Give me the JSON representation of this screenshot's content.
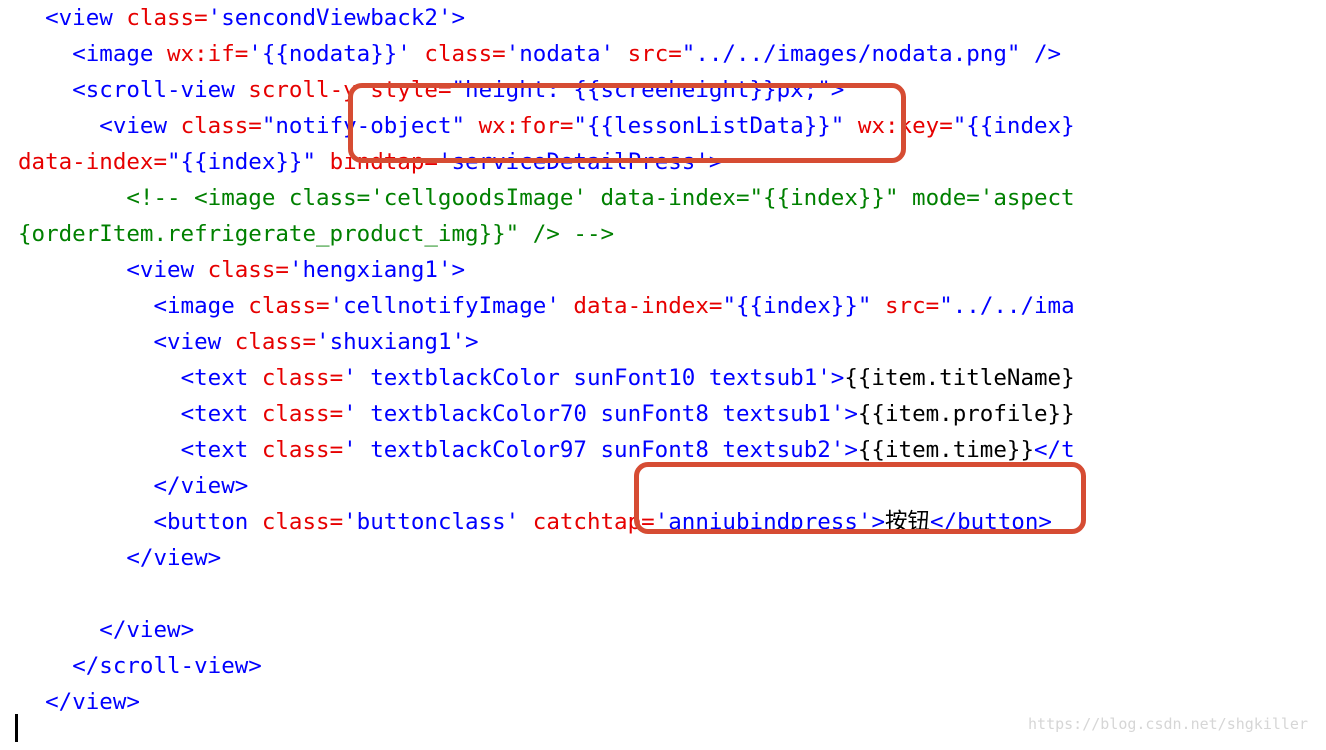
{
  "watermark": "https://blog.csdn.net/shgkiller",
  "lines": {
    "l1_indent": "  ",
    "l1_a": "<",
    "l1_b": "view",
    "l1_c": " ",
    "l1_d": "class",
    "l1_e": "=",
    "l1_f": "'sencondViewback2'",
    "l1_g": ">",
    "l2_indent": "    ",
    "l2_a": "<",
    "l2_b": "image",
    "l2_c": " ",
    "l2_d": "wx:if",
    "l2_e": "=",
    "l2_f": "'{{nodata}}'",
    "l2_g": " ",
    "l2_h": "class",
    "l2_i": "=",
    "l2_j": "'nodata'",
    "l2_k": " ",
    "l2_l": "src",
    "l2_m": "=",
    "l2_n": "\"../../images/nodata.png\"",
    "l2_o": " />",
    "l3_indent": "    ",
    "l3_a": "<",
    "l3_b": "scroll-view",
    "l3_c": " ",
    "l3_d": "scroll-y",
    "l3_e": " ",
    "l3_f": "style",
    "l3_g": "=",
    "l3_h": "\"height: {{screeheight}}px;\"",
    "l3_i": ">",
    "l4_indent": "      ",
    "l4_a": "<",
    "l4_b": "view",
    "l4_c": " ",
    "l4_d": "class",
    "l4_e": "=",
    "l4_f": "\"notify-object\"",
    "l4_g": " ",
    "l4_h": "wx:for",
    "l4_i": "=",
    "l4_j": "\"{{lessonListData}}\"",
    "l4_k": " ",
    "l4_l": "wx:key",
    "l4_m": "=",
    "l4_n": "\"{{index}",
    "l5_a": "data-index",
    "l5_b": "=",
    "l5_c": "\"{{index}}\"",
    "l5_d": " ",
    "l5_e": "bindtap",
    "l5_f": "=",
    "l5_g": "'serviceDetailPress'",
    "l5_h": ">",
    "l6_indent": "        ",
    "l6_text": "<!-- <image class='cellgoodsImage' data-index=\"{{index}}\" mode='aspect",
    "l7_text": "{orderItem.refrigerate_product_img}}\" /> -->",
    "l8_indent": "        ",
    "l8_a": "<",
    "l8_b": "view",
    "l8_c": " ",
    "l8_d": "class",
    "l8_e": "=",
    "l8_f": "'hengxiang1'",
    "l8_g": ">",
    "l9_indent": "          ",
    "l9_a": "<",
    "l9_b": "image",
    "l9_c": " ",
    "l9_d": "class",
    "l9_e": "=",
    "l9_f": "'cellnotifyImage'",
    "l9_g": " ",
    "l9_h": "data-index",
    "l9_i": "=",
    "l9_j": "\"{{index}}\"",
    "l9_k": " ",
    "l9_l": "src",
    "l9_m": "=",
    "l9_n": "\"../../ima",
    "l10_indent": "          ",
    "l10_a": "<",
    "l10_b": "view",
    "l10_c": " ",
    "l10_d": "class",
    "l10_e": "=",
    "l10_f": "'shuxiang1'",
    "l10_g": ">",
    "l11_indent": "            ",
    "l11_a": "<",
    "l11_b": "text",
    "l11_c": " ",
    "l11_d": "class",
    "l11_e": "=",
    "l11_f": "' textblackColor sunFont10 textsub1'",
    "l11_g": ">",
    "l11_h": "{{item.titleName}",
    "l12_indent": "            ",
    "l12_a": "<",
    "l12_b": "text",
    "l12_c": " ",
    "l12_d": "class",
    "l12_e": "=",
    "l12_f": "' textblackColor70 sunFont8 textsub1'",
    "l12_g": ">",
    "l12_h": "{{item.profile}}",
    "l13_indent": "            ",
    "l13_a": "<",
    "l13_b": "text",
    "l13_c": " ",
    "l13_d": "class",
    "l13_e": "=",
    "l13_f": "' textblackColor97 sunFont8 textsub2'",
    "l13_g": ">",
    "l13_h": "{{item.time}}",
    "l13_i": "</",
    "l13_j": "t",
    "l14_indent": "          ",
    "l14_a": "</",
    "l14_b": "view",
    "l14_c": ">",
    "l15_indent": "          ",
    "l15_a": "<",
    "l15_b": "button",
    "l15_c": " ",
    "l15_d": "class",
    "l15_e": "=",
    "l15_f": "'buttonclass'",
    "l15_g": " ",
    "l15_h": "catchtap",
    "l15_i": "=",
    "l15_j": "'anniubindpress'",
    "l15_k": ">",
    "l15_l": "按钮",
    "l15_m": "</",
    "l15_n": "button",
    "l15_o": ">",
    "l16_indent": "        ",
    "l16_a": "</",
    "l16_b": "view",
    "l16_c": ">",
    "l18_indent": "      ",
    "l18_a": "</",
    "l18_b": "view",
    "l18_c": ">",
    "l19_indent": "    ",
    "l19_a": "</",
    "l19_b": "scroll-view",
    "l19_c": ">",
    "l20_indent": "  ",
    "l20_a": "</",
    "l20_b": "view",
    "l20_c": ">"
  }
}
